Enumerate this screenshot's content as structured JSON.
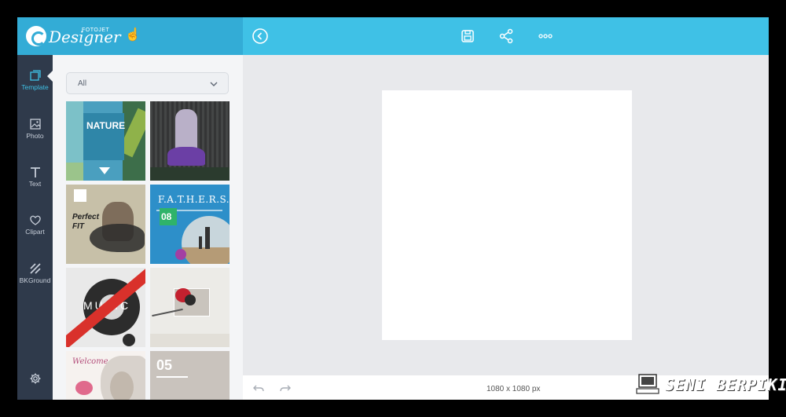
{
  "app": {
    "brand_top": "FOTOJET",
    "brand_name": "Designer"
  },
  "rail": {
    "items": [
      {
        "label": "Template",
        "icon": "template-icon"
      },
      {
        "label": "Photo",
        "icon": "photo-icon"
      },
      {
        "label": "Text",
        "icon": "text-icon"
      },
      {
        "label": "Clipart",
        "icon": "heart-icon"
      },
      {
        "label": "BKGround",
        "icon": "background-icon"
      }
    ]
  },
  "panel": {
    "filter_value": "All",
    "templates": [
      {
        "id": "nature",
        "title": "NATURE"
      },
      {
        "id": "purple-tree",
        "title": ""
      },
      {
        "id": "perfect-fit",
        "title": "Perfect FIT"
      },
      {
        "id": "fathers",
        "title": "F.A.T.H.E.R.S.",
        "badge": "08"
      },
      {
        "id": "music",
        "title": "MUSIC"
      },
      {
        "id": "flower-card",
        "title": ""
      },
      {
        "id": "welcome",
        "title": "Welcome"
      },
      {
        "id": "heart-05",
        "title": "05"
      }
    ]
  },
  "canvas": {
    "size_label": "1080 x 1080 px"
  },
  "watermark": {
    "text": "SENI BERPIKIR"
  },
  "colors": {
    "topbar": "#3fc1e6",
    "brand_bg": "#33acd6",
    "rail": "#2f3a4b",
    "accent": "#3fc1e6"
  }
}
